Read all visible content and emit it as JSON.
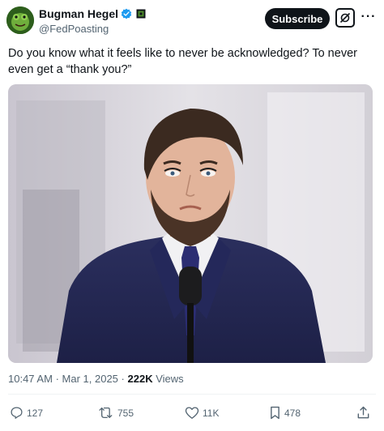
{
  "author": {
    "display_name": "Bugman Hegel",
    "handle": "@FedPoasting",
    "verified": true,
    "avatar_icon": "frog-avatar-icon"
  },
  "header": {
    "subscribe_label": "Subscribe",
    "grok_icon": "grok-icon",
    "more_icon": "more-icon",
    "more_label": "···"
  },
  "post": {
    "text": "Do you know what it feels like to never be acknowledged? To never even get a “thank you?”",
    "image_icon": "photo-of-man-in-suit-at-microphone"
  },
  "meta": {
    "time": "10:47 AM",
    "separator": "·",
    "date": "Mar 1, 2025",
    "views_count": "222K",
    "views_label": "Views"
  },
  "actions": {
    "replies": "127",
    "reposts": "755",
    "likes": "11K",
    "bookmarks": "478"
  },
  "colors": {
    "accent": "#1d9bf0",
    "text": "#0f1419",
    "secondary": "#536471",
    "button_bg": "#0f1419"
  }
}
